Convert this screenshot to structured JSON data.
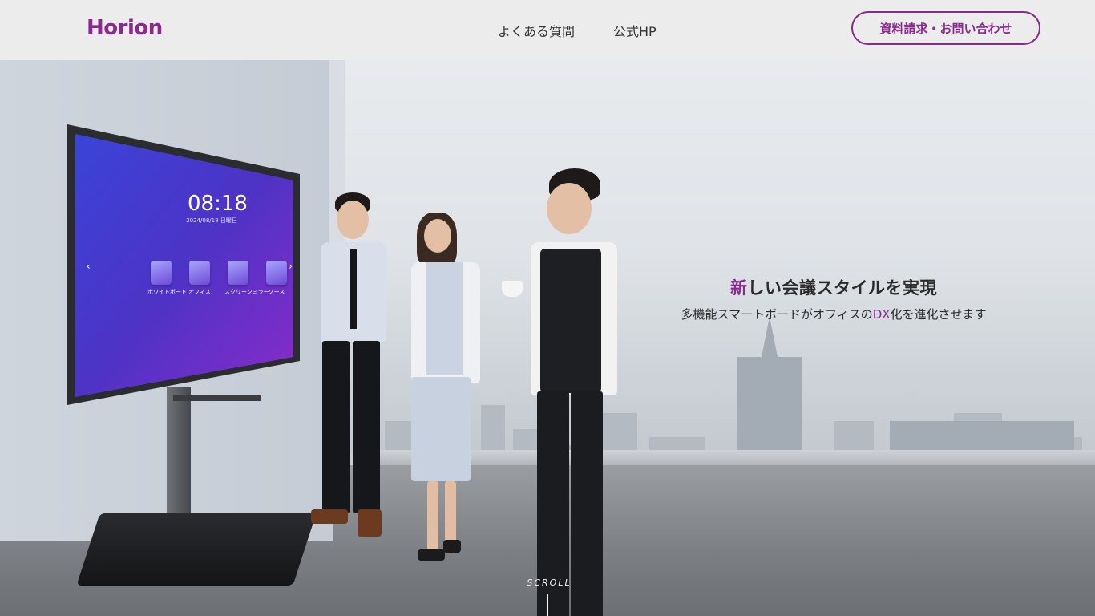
{
  "header": {
    "logo": "Horion",
    "nav": [
      {
        "label": "よくある質問"
      },
      {
        "label": "公式HP"
      }
    ],
    "cta_label": "資料請求・お問い合わせ"
  },
  "hero": {
    "title_accent": "新",
    "title_rest": "しい会議スタイルを実現",
    "subtitle_pre": "多機能スマートボードがオフィスの",
    "subtitle_accent": "DX",
    "subtitle_post": "化を進化させます",
    "scroll_label": "SCROLL",
    "screen": {
      "time": "08:18",
      "date": "2024/08/18  日曜日",
      "apps": [
        {
          "label": "ホワイトボード"
        },
        {
          "label": "オフィス"
        },
        {
          "label": "スクリーンミラー"
        },
        {
          "label": "ソース"
        }
      ],
      "prev_arrow": "‹",
      "next_arrow": "›"
    }
  },
  "colors": {
    "brand": "#8a2a8e",
    "header_bg": "#ececec",
    "text": "#333333"
  }
}
